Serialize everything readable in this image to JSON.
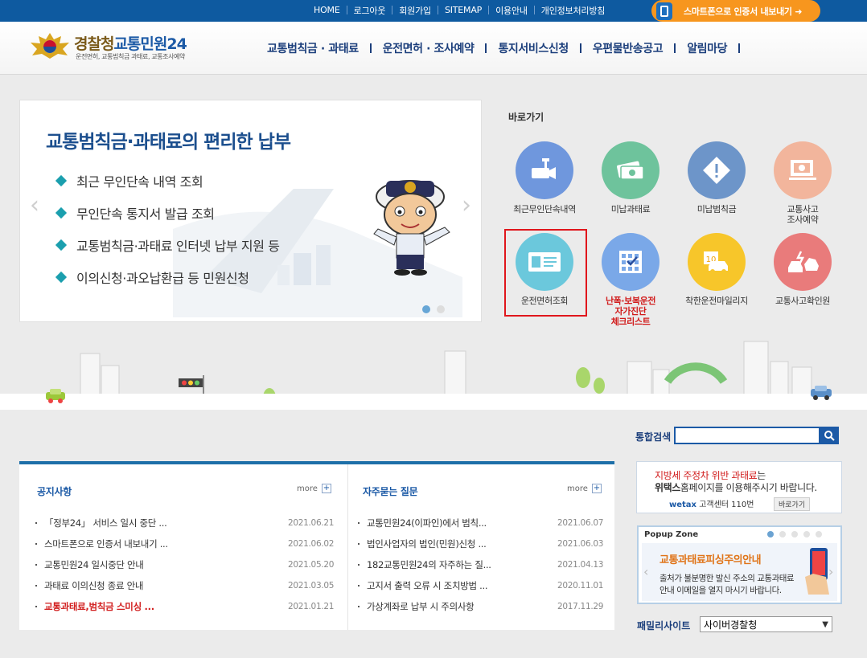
{
  "top_nav": {
    "links": [
      "HOME",
      "로그아웃",
      "회원가입",
      "SITEMAP",
      "이용안내",
      "개인정보처리방침"
    ],
    "smartphone_button": "스마트폰으로 인증서 내보내기 ➜"
  },
  "header": {
    "logo_title_a": "경찰청",
    "logo_title_b": "교통민원24",
    "logo_subtitle": "운전면허, 교통범칙금 과태료, 교통조사예약",
    "menu": [
      "교통범칙금 · 과태료",
      "운전면허 · 조사예약",
      "통지서비스신청",
      "우편물반송공고",
      "알림마당"
    ]
  },
  "slider": {
    "headline": "교통범칙금·과태료의 편리한 납부",
    "items": [
      "최근 무인단속 내역 조회",
      "무인단속 통지서 발급 조회",
      "교통범칙금·과태료 인터넷 납부 지원 등",
      "이의신청·과오납환급 등 민원신청"
    ]
  },
  "quick_links": {
    "title": "바로가기",
    "items": [
      {
        "label": "최근무인단속내역",
        "color": "#6f97dd",
        "icon": "cctv-camera-icon"
      },
      {
        "label": "미납과태료",
        "color": "#6ec39c",
        "icon": "money-icon"
      },
      {
        "label": "미납범칙금",
        "color": "#6d95c9",
        "icon": "warning-icon"
      },
      {
        "label": "교통사고\n조사예약",
        "color": "#f2b59c",
        "icon": "monitor-icon"
      },
      {
        "label": "운전면허조회",
        "color": "#6bc8dc",
        "icon": "license-card-icon"
      },
      {
        "label": "난폭·보복운전\n자가진단\n체크리스트",
        "color": "#7aa8e8",
        "icon": "calendar-check-icon"
      },
      {
        "label": "착한운전마일리지",
        "color": "#f7c62a",
        "icon": "mileage-car-icon"
      },
      {
        "label": "교통사고확인원",
        "color": "#e97b7b",
        "icon": "car-crash-icon"
      }
    ]
  },
  "search": {
    "label": "통합검색",
    "placeholder": ""
  },
  "notices": {
    "title": "공지사항",
    "more": "more",
    "rows": [
      {
        "text": "「정부24」 서비스 일시 중단 ...",
        "date": "2021.06.21"
      },
      {
        "text": "스마트폰으로 인증서 내보내기 ...",
        "date": "2021.06.02"
      },
      {
        "text": "교통민원24 일시중단 안내",
        "date": "2021.05.20"
      },
      {
        "text": "과태료 이의신청 종료 안내",
        "date": "2021.03.05"
      },
      {
        "text": "교통과태료,범칙금 스미싱 ...",
        "date": "2021.01.21"
      }
    ]
  },
  "faq": {
    "title": "자주묻는 질문",
    "more": "more",
    "rows": [
      {
        "text": "교통민원24(이파인)에서 범칙...",
        "date": "2021.06.07"
      },
      {
        "text": "법인사업자의 법인(민원)신청 ...",
        "date": "2021.06.03"
      },
      {
        "text": "182교통민원24의 자주하는 질...",
        "date": "2021.04.13"
      },
      {
        "text": "고지서 출력 오류 시 조치방법 ...",
        "date": "2020.11.01"
      },
      {
        "text": "가상계좌로 납부 시 주의사항",
        "date": "2017.11.29"
      }
    ]
  },
  "wetax_banner": {
    "line1_red": "지방세 주정차 위반 과태료",
    "line1_rest": "는",
    "line2_bold": "위택스",
    "line2_rest": "홈페이지를 이용해주시기 바랍니다.",
    "brand": "wetax",
    "center": "고객센터 110번",
    "button": "바로가기"
  },
  "popup_zone": {
    "title": "Popup Zone",
    "headline": "교통과태료피싱주의안내",
    "line1": "출처가 불분명한 발신 주소의 교통과태료",
    "line2": "안내 이메일을 열지 마시기 바랍니다."
  },
  "family_site": {
    "label": "패밀리사이트",
    "selected": "사이버경찰청"
  },
  "colors": {
    "topbar": "#0e5aa0",
    "accent_orange": "#f7961e",
    "highlight_red": "#e0161c",
    "board_top": "#1d6fa8"
  }
}
